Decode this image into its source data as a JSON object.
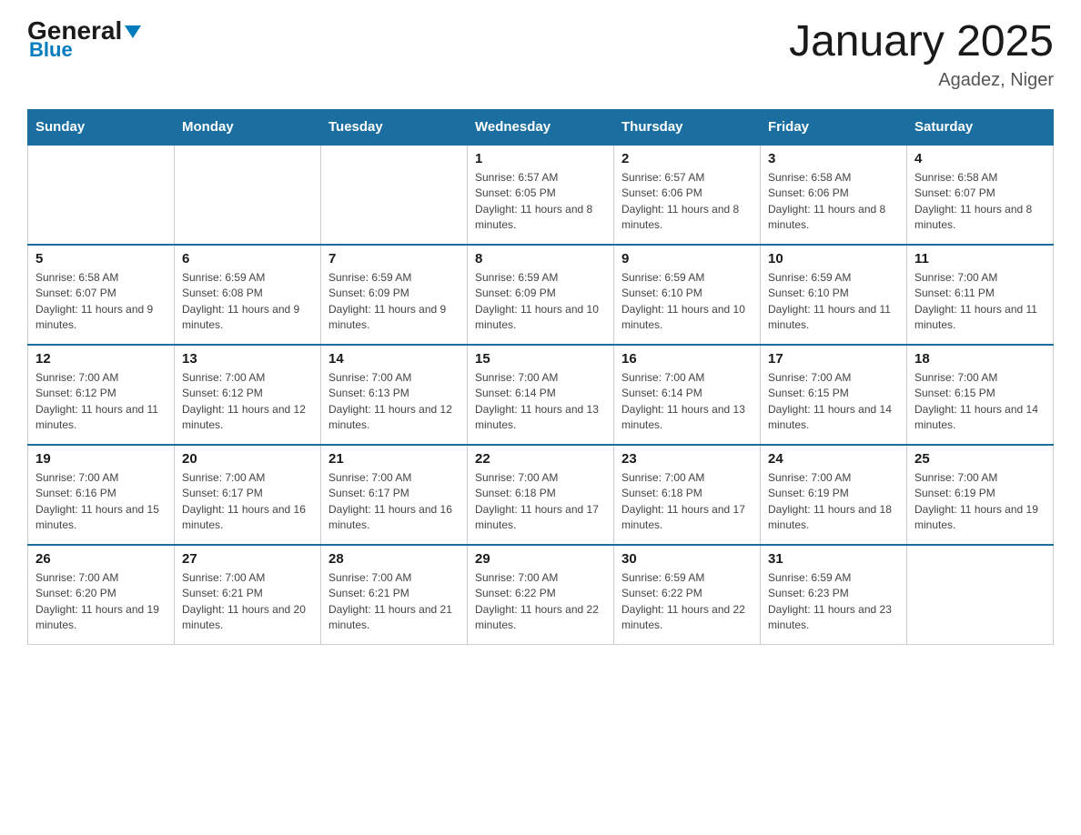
{
  "header": {
    "logo_general": "General",
    "logo_triangle": "▶",
    "logo_blue": "Blue",
    "title": "January 2025",
    "subtitle": "Agadez, Niger"
  },
  "weekdays": [
    "Sunday",
    "Monday",
    "Tuesday",
    "Wednesday",
    "Thursday",
    "Friday",
    "Saturday"
  ],
  "weeks": [
    [
      {
        "day": "",
        "info": ""
      },
      {
        "day": "",
        "info": ""
      },
      {
        "day": "",
        "info": ""
      },
      {
        "day": "1",
        "info": "Sunrise: 6:57 AM\nSunset: 6:05 PM\nDaylight: 11 hours and 8 minutes."
      },
      {
        "day": "2",
        "info": "Sunrise: 6:57 AM\nSunset: 6:06 PM\nDaylight: 11 hours and 8 minutes."
      },
      {
        "day": "3",
        "info": "Sunrise: 6:58 AM\nSunset: 6:06 PM\nDaylight: 11 hours and 8 minutes."
      },
      {
        "day": "4",
        "info": "Sunrise: 6:58 AM\nSunset: 6:07 PM\nDaylight: 11 hours and 8 minutes."
      }
    ],
    [
      {
        "day": "5",
        "info": "Sunrise: 6:58 AM\nSunset: 6:07 PM\nDaylight: 11 hours and 9 minutes."
      },
      {
        "day": "6",
        "info": "Sunrise: 6:59 AM\nSunset: 6:08 PM\nDaylight: 11 hours and 9 minutes."
      },
      {
        "day": "7",
        "info": "Sunrise: 6:59 AM\nSunset: 6:09 PM\nDaylight: 11 hours and 9 minutes."
      },
      {
        "day": "8",
        "info": "Sunrise: 6:59 AM\nSunset: 6:09 PM\nDaylight: 11 hours and 10 minutes."
      },
      {
        "day": "9",
        "info": "Sunrise: 6:59 AM\nSunset: 6:10 PM\nDaylight: 11 hours and 10 minutes."
      },
      {
        "day": "10",
        "info": "Sunrise: 6:59 AM\nSunset: 6:10 PM\nDaylight: 11 hours and 11 minutes."
      },
      {
        "day": "11",
        "info": "Sunrise: 7:00 AM\nSunset: 6:11 PM\nDaylight: 11 hours and 11 minutes."
      }
    ],
    [
      {
        "day": "12",
        "info": "Sunrise: 7:00 AM\nSunset: 6:12 PM\nDaylight: 11 hours and 11 minutes."
      },
      {
        "day": "13",
        "info": "Sunrise: 7:00 AM\nSunset: 6:12 PM\nDaylight: 11 hours and 12 minutes."
      },
      {
        "day": "14",
        "info": "Sunrise: 7:00 AM\nSunset: 6:13 PM\nDaylight: 11 hours and 12 minutes."
      },
      {
        "day": "15",
        "info": "Sunrise: 7:00 AM\nSunset: 6:14 PM\nDaylight: 11 hours and 13 minutes."
      },
      {
        "day": "16",
        "info": "Sunrise: 7:00 AM\nSunset: 6:14 PM\nDaylight: 11 hours and 13 minutes."
      },
      {
        "day": "17",
        "info": "Sunrise: 7:00 AM\nSunset: 6:15 PM\nDaylight: 11 hours and 14 minutes."
      },
      {
        "day": "18",
        "info": "Sunrise: 7:00 AM\nSunset: 6:15 PM\nDaylight: 11 hours and 14 minutes."
      }
    ],
    [
      {
        "day": "19",
        "info": "Sunrise: 7:00 AM\nSunset: 6:16 PM\nDaylight: 11 hours and 15 minutes."
      },
      {
        "day": "20",
        "info": "Sunrise: 7:00 AM\nSunset: 6:17 PM\nDaylight: 11 hours and 16 minutes."
      },
      {
        "day": "21",
        "info": "Sunrise: 7:00 AM\nSunset: 6:17 PM\nDaylight: 11 hours and 16 minutes."
      },
      {
        "day": "22",
        "info": "Sunrise: 7:00 AM\nSunset: 6:18 PM\nDaylight: 11 hours and 17 minutes."
      },
      {
        "day": "23",
        "info": "Sunrise: 7:00 AM\nSunset: 6:18 PM\nDaylight: 11 hours and 17 minutes."
      },
      {
        "day": "24",
        "info": "Sunrise: 7:00 AM\nSunset: 6:19 PM\nDaylight: 11 hours and 18 minutes."
      },
      {
        "day": "25",
        "info": "Sunrise: 7:00 AM\nSunset: 6:19 PM\nDaylight: 11 hours and 19 minutes."
      }
    ],
    [
      {
        "day": "26",
        "info": "Sunrise: 7:00 AM\nSunset: 6:20 PM\nDaylight: 11 hours and 19 minutes."
      },
      {
        "day": "27",
        "info": "Sunrise: 7:00 AM\nSunset: 6:21 PM\nDaylight: 11 hours and 20 minutes."
      },
      {
        "day": "28",
        "info": "Sunrise: 7:00 AM\nSunset: 6:21 PM\nDaylight: 11 hours and 21 minutes."
      },
      {
        "day": "29",
        "info": "Sunrise: 7:00 AM\nSunset: 6:22 PM\nDaylight: 11 hours and 22 minutes."
      },
      {
        "day": "30",
        "info": "Sunrise: 6:59 AM\nSunset: 6:22 PM\nDaylight: 11 hours and 22 minutes."
      },
      {
        "day": "31",
        "info": "Sunrise: 6:59 AM\nSunset: 6:23 PM\nDaylight: 11 hours and 23 minutes."
      },
      {
        "day": "",
        "info": ""
      }
    ]
  ]
}
